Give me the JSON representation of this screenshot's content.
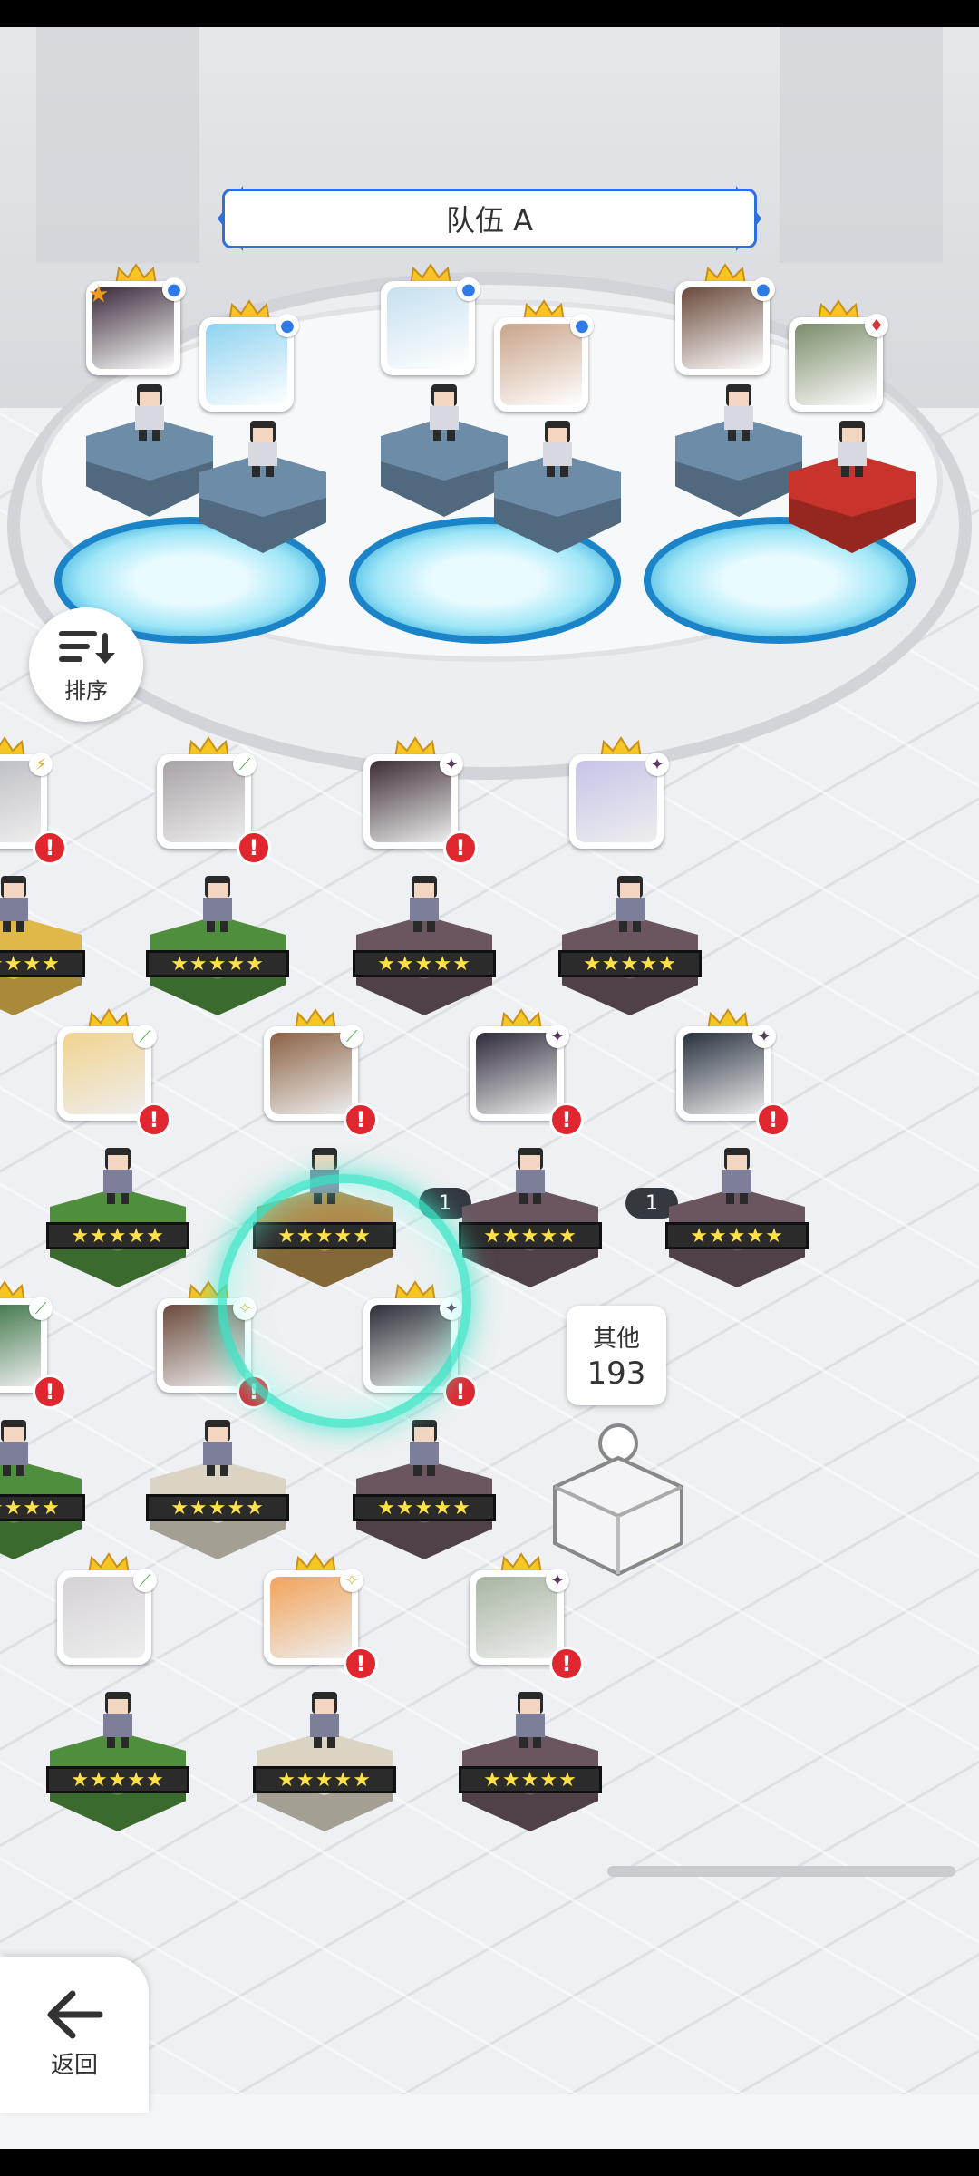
{
  "team": {
    "title": "队伍 A"
  },
  "sort_button": {
    "label": "排序"
  },
  "other": {
    "label": "其他",
    "count": "193"
  },
  "back_button": {
    "label": "返回"
  },
  "team_members": [
    {
      "art": "#3a2a3a",
      "elem": "#2f7ae5",
      "elem_icon": "●",
      "pedestal": "#6c8ca8",
      "star_mark": "★"
    },
    {
      "art": "#8fd2f0",
      "elem": "#2f7ae5",
      "elem_icon": "●",
      "pedestal": "#6c8ca8"
    },
    {
      "art": "#c7e0ef",
      "elem": "#2f7ae5",
      "elem_icon": "●",
      "pedestal": "#6c8ca8"
    },
    {
      "art": "#c9a48a",
      "elem": "#2f7ae5",
      "elem_icon": "●",
      "pedestal": "#6c8ca8"
    },
    {
      "art": "#6a4a3c",
      "elem": "#2f7ae5",
      "elem_icon": "●",
      "pedestal": "#6c8ca8"
    },
    {
      "art": "#7a8c6a",
      "elem": "#d8323b",
      "elem_icon": "♦",
      "pedestal": "#c8332b"
    }
  ],
  "roster": [
    {
      "art": "#b9b9c2",
      "elem_icon": "⚡",
      "elem_color": "#e0a920",
      "pedestal": "#e0b84a",
      "stars": "★★★★★",
      "alert": "!"
    },
    {
      "art": "#a8a2a6",
      "elem_icon": "⟋",
      "elem_color": "#4aa844",
      "pedestal": "#4f8e3d",
      "stars": "★★★★★",
      "alert": "!"
    },
    {
      "art": "#3c2d35",
      "elem_icon": "✦",
      "elem_color": "#5a3b5e",
      "pedestal": "#6b5560",
      "stars": "★★★★★",
      "alert": "!"
    },
    {
      "art": "#c6c4e8",
      "elem_icon": "✦",
      "elem_color": "#5a3b5e",
      "pedestal": "#6b5560",
      "stars": "★★★★★"
    },
    {
      "art": "#f1d38e",
      "elem_icon": "⟋",
      "elem_color": "#4aa844",
      "pedestal": "#4f8e3d",
      "stars": "★★★★★",
      "alert": "!"
    },
    {
      "art": "#8b6244",
      "elem_icon": "⟋",
      "elem_color": "#4aa844",
      "pedestal": "#b08a4a",
      "stars": "★★★★★",
      "alert": "!"
    },
    {
      "art": "#2e2a3a",
      "elem_icon": "✦",
      "elem_color": "#5a3b5e",
      "pedestal": "#6b5560",
      "stars": "★★★★★",
      "alert": "!",
      "count": "1"
    },
    {
      "art": "#27303e",
      "elem_icon": "✦",
      "elem_color": "#5a3b5e",
      "pedestal": "#6b5560",
      "stars": "★★★★★",
      "alert": "!",
      "count": "1"
    },
    {
      "art": "#2d6a3a",
      "elem_icon": "⟋",
      "elem_color": "#4aa844",
      "pedestal": "#4f8e3d",
      "stars": "★★★★★",
      "alert": "!"
    },
    {
      "art": "#6b4a3c",
      "elem_icon": "✧",
      "elem_color": "#d8c454",
      "pedestal": "#d9d4c4",
      "stars": "★★★★★",
      "alert": "!"
    },
    {
      "art": "#2a2e36",
      "elem_icon": "✦",
      "elem_color": "#5a3b5e",
      "pedestal": "#6b5560",
      "stars": "★★★★★",
      "alert": "!"
    },
    {
      "art": "#d5d2d6",
      "elem_icon": "⟋",
      "elem_color": "#4aa844",
      "pedestal": "#4f8e3d",
      "stars": "★★★★★"
    },
    {
      "art": "#f2a35a",
      "elem_icon": "✧",
      "elem_color": "#d8c454",
      "pedestal": "#d9d4c4",
      "stars": "★★★★★",
      "alert": "!"
    },
    {
      "art": "#a8b6a2",
      "elem_icon": "✦",
      "elem_color": "#5a3b5e",
      "pedestal": "#6b5560",
      "stars": "★★★★★",
      "alert": "!"
    }
  ]
}
